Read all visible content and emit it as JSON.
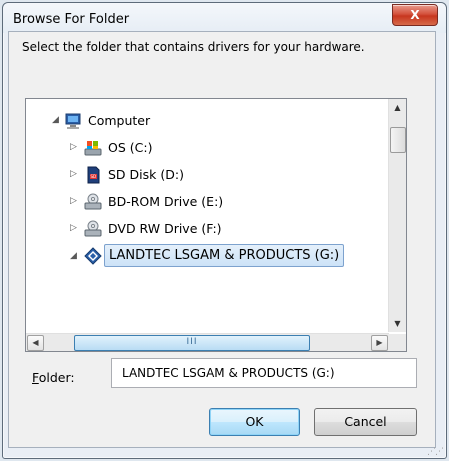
{
  "window": {
    "title": "Browse For Folder",
    "close_label": "X"
  },
  "description": "Select the folder that contains drivers for your hardware.",
  "tree": {
    "items": [
      {
        "label": "Computer",
        "icon": "computer-icon",
        "expanded": true
      },
      {
        "label": "OS (C:)",
        "icon": "os-drive-icon",
        "expanded": false
      },
      {
        "label": "SD Disk (D:)",
        "icon": "sd-card-icon",
        "expanded": false
      },
      {
        "label": "BD-ROM Drive (E:)",
        "icon": "optical-drive-icon",
        "expanded": false
      },
      {
        "label": "DVD RW Drive (F:)",
        "icon": "optical-drive-icon",
        "expanded": false
      },
      {
        "label": "LANDTEC LSGAM & PRODUCTS (G:)",
        "icon": "usb-drive-icon",
        "expanded": true,
        "selected": true
      }
    ],
    "hscroll_grip": "III"
  },
  "folder": {
    "label_underlined": "F",
    "label_rest": "older:",
    "value": "LANDTEC LSGAM & PRODUCTS (G:)"
  },
  "buttons": {
    "ok": "OK",
    "cancel": "Cancel"
  },
  "colors": {
    "close_button": "#c7361f",
    "selection_border": "#7da2ce",
    "ok_border": "#3c7fb1"
  }
}
